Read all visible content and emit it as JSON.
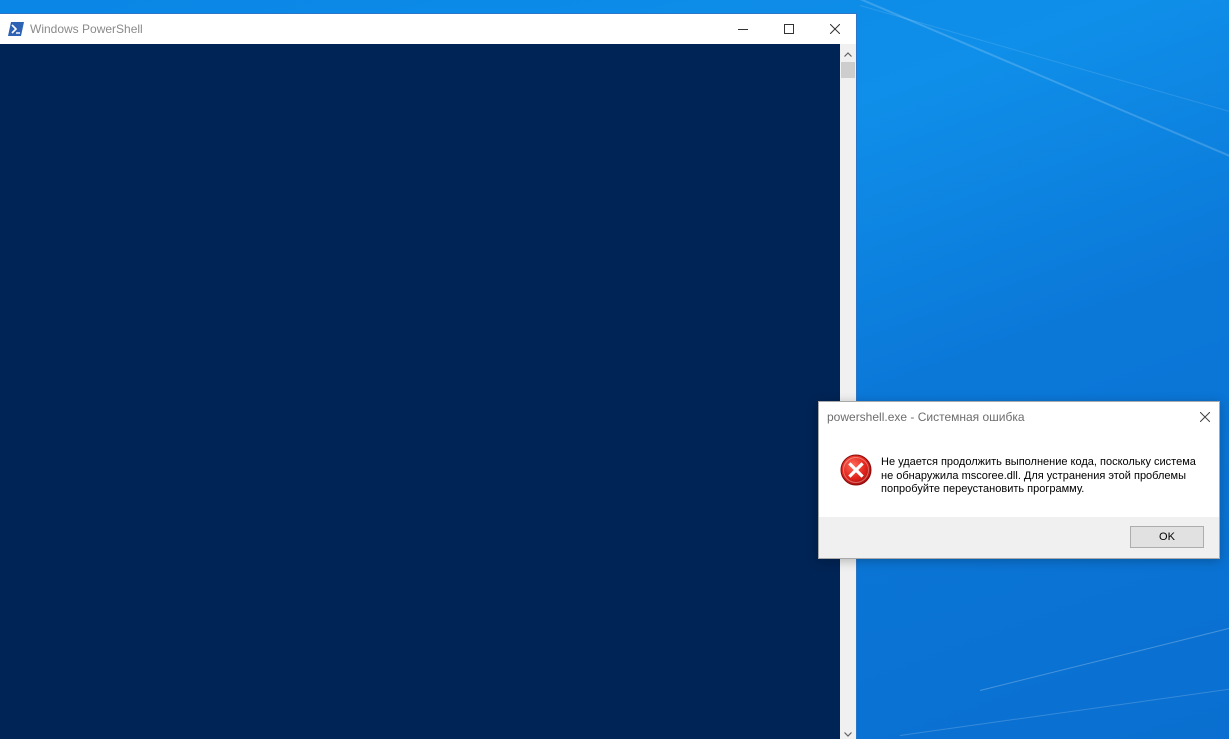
{
  "desktop": {
    "background_color": "#0f8fe9"
  },
  "powershell_window": {
    "title": "Windows PowerShell",
    "console_color": "#012456",
    "icons": {
      "app": "powershell-icon",
      "minimize": "minimize-icon",
      "maximize": "maximize-icon",
      "close": "close-icon"
    }
  },
  "error_dialog": {
    "title": "powershell.exe - Системная ошибка",
    "message": "Не удается продолжить выполнение кода, поскольку система не обнаружила mscoree.dll. Для устранения этой проблемы попробуйте переустановить программу.",
    "ok_label": "OK",
    "icon": "error-icon",
    "icon_color": "#e81123"
  }
}
